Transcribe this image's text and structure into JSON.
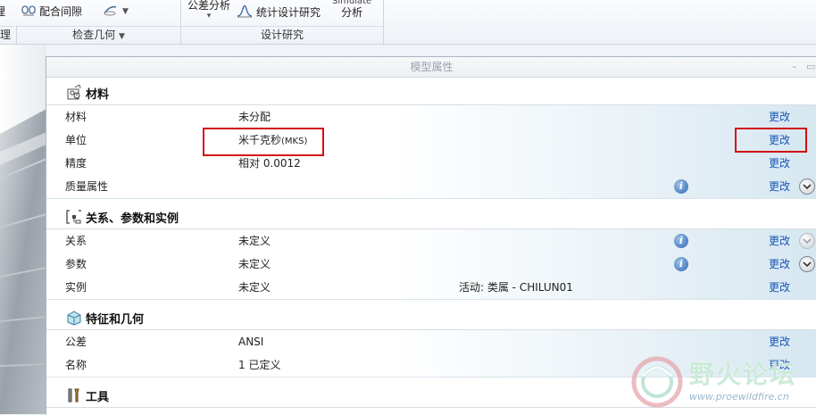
{
  "ribbon": {
    "left_cut_label": "理",
    "fit_clearance": "配合间隙",
    "tolerance_analysis": "公差分析",
    "stat_design_study": "统计设计研究",
    "simulate_top": "Simulate",
    "simulate_bottom": "分析",
    "groups": {
      "left_cut": "理",
      "check_geometry": "检查几何",
      "design_study": "设计研究"
    }
  },
  "dialog": {
    "title": "模型属性",
    "sections": {
      "material": {
        "title": "材料",
        "rows": [
          {
            "label": "材料",
            "value": "未分配",
            "action": "更改"
          },
          {
            "label": "单位",
            "value": "米千克秒",
            "value_suffix": "(MKS)",
            "action": "更改"
          },
          {
            "label": "精度",
            "value": "相对 0.0012",
            "action": "更改"
          },
          {
            "label": "质量属性",
            "value": "",
            "action": "更改"
          }
        ]
      },
      "relations": {
        "title": "关系、参数和实例",
        "rows": [
          {
            "label": "关系",
            "value": "未定义",
            "action": "更改"
          },
          {
            "label": "参数",
            "value": "未定义",
            "action": "更改"
          },
          {
            "label": "实例",
            "value": "未定义",
            "extra": "活动: 类属 - CHILUN01",
            "action": "更改"
          }
        ]
      },
      "features": {
        "title": "特征和几何",
        "rows": [
          {
            "label": "公差",
            "value": "ANSI",
            "action": "更改"
          },
          {
            "label": "名称",
            "value": "1 已定义",
            "action": "更改"
          }
        ]
      },
      "tools": {
        "title": "工具"
      }
    }
  },
  "watermark": {
    "title": "野火论坛",
    "url": "www.proewildfire.cn"
  },
  "colors": {
    "highlight_box": "#d20d12",
    "link": "#1a55b8",
    "info_icon": "#2c66b3"
  }
}
